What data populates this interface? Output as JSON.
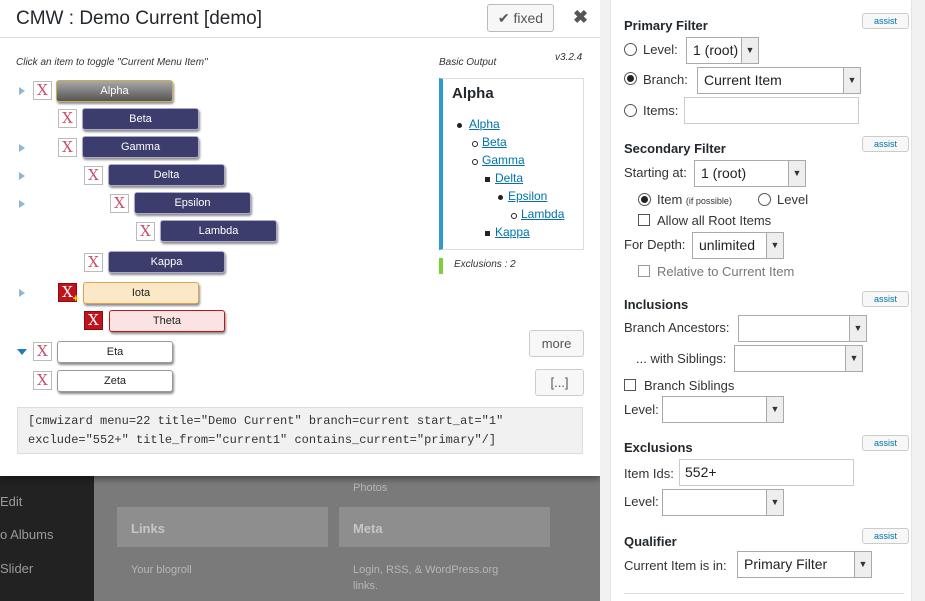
{
  "background": {
    "admin_menu": [
      "Edit",
      "o Albums",
      "Slider"
    ],
    "photos_text": "Photos",
    "widgets": [
      {
        "title": "Links",
        "text": "Your blogroll"
      },
      {
        "title": "Meta",
        "text": "Login, RSS, & WordPress.org links."
      }
    ]
  },
  "dialog": {
    "title": "CMW : Demo Current [demo]",
    "fixed_label": "fixed",
    "fixed_icon": "checkmark-icon",
    "close_label": "✖",
    "hint": "Click an item to toggle \"Current Menu Item\"",
    "basic_output_label": "Basic Output",
    "version": "v3.2.4",
    "x_glyph": "X",
    "plus_glyph": "+",
    "items": [
      {
        "label": "Alpha",
        "style": "current"
      },
      {
        "label": "Beta",
        "style": "in-branch"
      },
      {
        "label": "Gamma",
        "style": "in-branch"
      },
      {
        "label": "Delta",
        "style": "in-branch"
      },
      {
        "label": "Epsilon",
        "style": "in-branch"
      },
      {
        "label": "Lambda",
        "style": "in-branch"
      },
      {
        "label": "Kappa",
        "style": "in-branch"
      },
      {
        "label": "Iota",
        "style": "excluded-plus"
      },
      {
        "label": "Theta",
        "style": "excluded"
      },
      {
        "label": "Eta",
        "style": "out"
      },
      {
        "label": "Zeta",
        "style": "out"
      }
    ],
    "basic_output": {
      "title": "Alpha",
      "links": [
        "Alpha",
        "Beta",
        "Gamma",
        "Delta",
        "Epsilon",
        "Lambda",
        "Kappa"
      ]
    },
    "exclusions": "Exclusions : 2",
    "more_label": "more",
    "ellipsis_label": "[...]",
    "shortcode_line1": "[cmwizard menu=22 title=\"Demo Current\" branch=current start_at=\"1\"",
    "shortcode_line2": "exclude=\"552+\" title_from=\"current1\" contains_current=\"primary\"/]"
  },
  "panel": {
    "assist_label": "assist",
    "primary": {
      "title": "Primary Filter",
      "level_label": "Level:",
      "level_value": "1 (root)",
      "branch_label": "Branch:",
      "branch_value": "Current Item",
      "items_label": "Items:",
      "items_value": "",
      "selected": "branch"
    },
    "secondary": {
      "title": "Secondary Filter",
      "starting_label": "Starting at:",
      "starting_value": "1 (root)",
      "item_label": "Item",
      "item_note": "(if possible)",
      "level_label": "Level",
      "allow_root_label": "Allow all Root Items",
      "depth_label": "For Depth:",
      "depth_value": "unlimited",
      "relative_label": "Relative to Current Item"
    },
    "inclusions": {
      "title": "Inclusions",
      "ancestors_label": "Branch Ancestors:",
      "ancestors_value": "",
      "siblings_label": "... with Siblings:",
      "siblings_value": "",
      "branch_siblings_label": "Branch Siblings",
      "level_label": "Level:",
      "level_value": ""
    },
    "exclusions": {
      "title": "Exclusions",
      "item_ids_label": "Item Ids:",
      "item_ids_value": "552+",
      "level_label": "Level:",
      "level_value": ""
    },
    "qualifier": {
      "title": "Qualifier",
      "current_label": "Current Item is in:",
      "current_value": "Primary Filter"
    }
  },
  "colors": {
    "navy_item": "#3c3c6d",
    "excluded_red": "#c0141c",
    "link_blue": "#0073aa",
    "accent_blue": "#2e9ad0",
    "exclusions_green": "#7ad03a"
  }
}
